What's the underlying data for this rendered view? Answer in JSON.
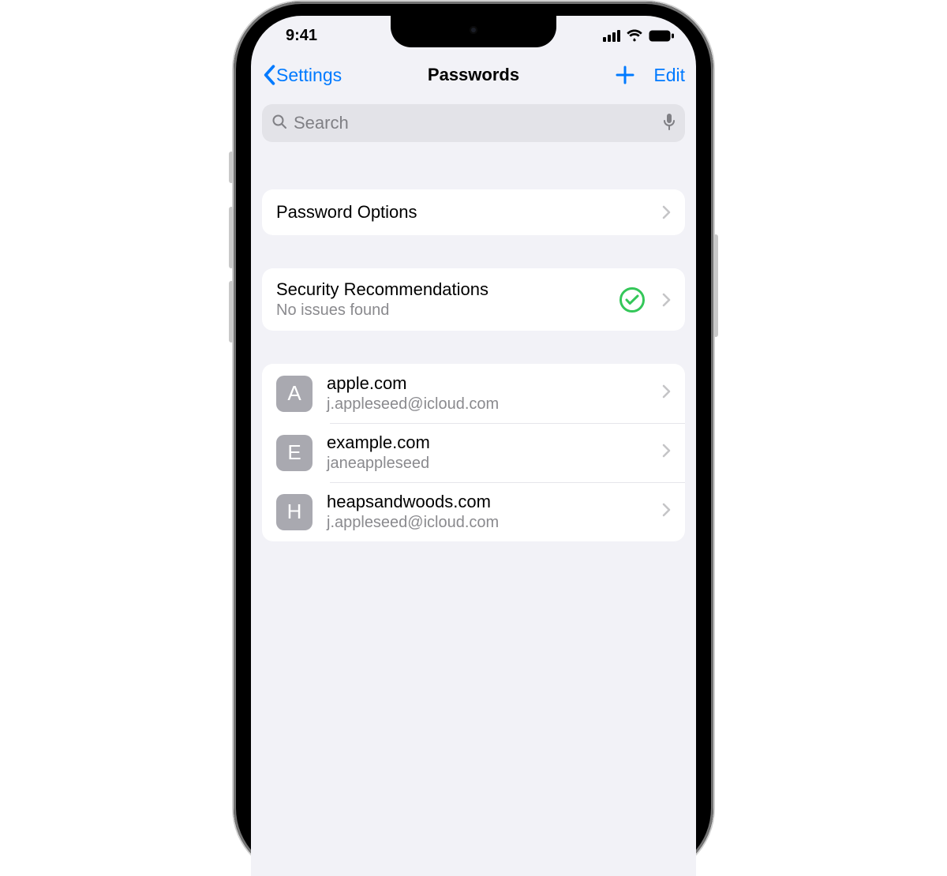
{
  "statusbar": {
    "time": "9:41"
  },
  "nav": {
    "back_label": "Settings",
    "title": "Passwords",
    "edit_label": "Edit"
  },
  "search": {
    "placeholder": "Search",
    "value": ""
  },
  "options_cell": {
    "label": "Password Options"
  },
  "security_cell": {
    "title": "Security Recommendations",
    "subtitle": "No issues found",
    "status": "ok",
    "status_color": "#34c759"
  },
  "passwords": [
    {
      "letter": "A",
      "site": "apple.com",
      "user": "j.appleseed@icloud.com"
    },
    {
      "letter": "E",
      "site": "example.com",
      "user": "janeappleseed"
    },
    {
      "letter": "H",
      "site": "heapsandwoods.com",
      "user": "j.appleseed@icloud.com"
    }
  ],
  "colors": {
    "accent": "#007aff",
    "bg": "#f2f2f7",
    "cell_bg": "#ffffff",
    "secondary_text": "#8a8a8e",
    "separator": "#e5e5ea",
    "icon_tile": "#a9a9b0",
    "ok_green": "#34c759"
  }
}
